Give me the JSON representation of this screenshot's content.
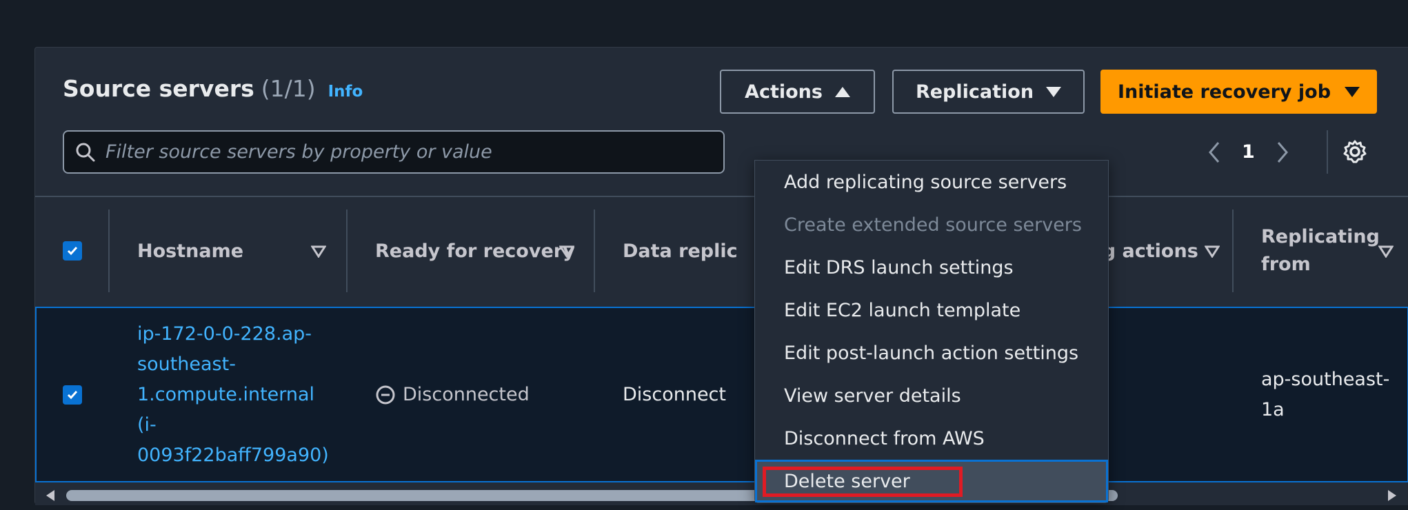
{
  "header": {
    "title": "Source servers",
    "count": "(1/1)",
    "info_link": "Info"
  },
  "toolbar": {
    "actions_label": "Actions",
    "replication_label": "Replication",
    "primary_label": "Initiate recovery job"
  },
  "search": {
    "placeholder": "Filter source servers by property or value",
    "value": ""
  },
  "pagination": {
    "current_page": "1"
  },
  "table": {
    "columns": [
      {
        "label": "Hostname"
      },
      {
        "label": "Ready for recovery"
      },
      {
        "label": "Data replic"
      },
      {
        "label": "ding actions"
      },
      {
        "label": "Replicating from"
      }
    ],
    "rows": [
      {
        "selected": true,
        "hostname": [
          "ip-172-0-0-228.ap-",
          "southeast-",
          "1.compute.internal",
          "(i-",
          "0093f22baff799a90)"
        ],
        "ready_for_recovery": "Disconnected",
        "data_replication": "Disconnect",
        "replicating_from": [
          "ap-southeast-",
          "1a"
        ]
      }
    ]
  },
  "actions_menu": {
    "items": [
      {
        "label": "Add replicating source servers",
        "disabled": false
      },
      {
        "label": "Create extended source servers",
        "disabled": true
      },
      {
        "label": "Edit DRS launch settings",
        "disabled": false
      },
      {
        "label": "Edit EC2 launch template",
        "disabled": false
      },
      {
        "label": "Edit post-launch action settings",
        "disabled": false
      },
      {
        "label": "View server details",
        "disabled": false
      },
      {
        "label": "Disconnect from AWS",
        "disabled": false
      },
      {
        "label": "Delete server",
        "disabled": false,
        "highlighted": true
      }
    ]
  },
  "colors": {
    "accent_orange": "#ff9900",
    "link_blue": "#42b4ff",
    "select_blue": "#0972d3",
    "highlight_red": "#e01b24"
  }
}
